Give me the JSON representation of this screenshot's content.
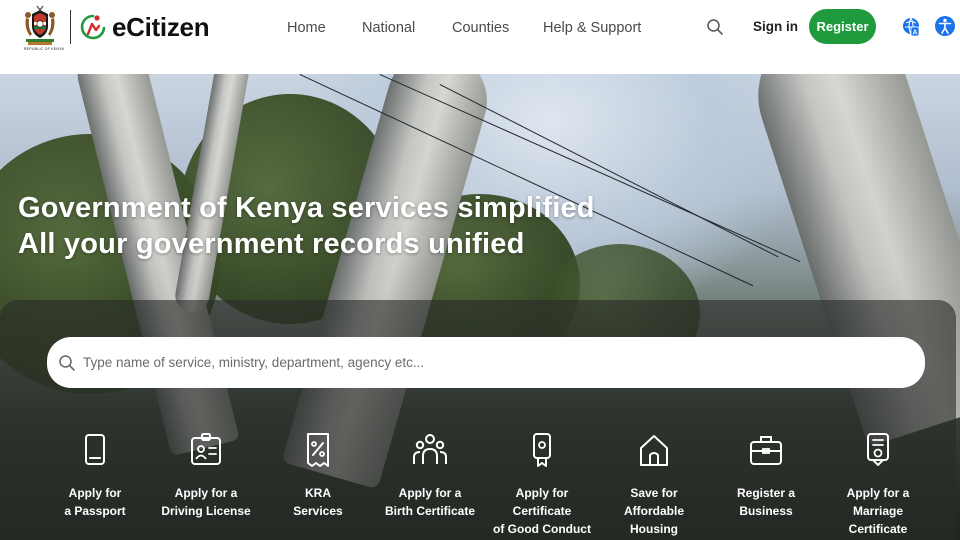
{
  "header": {
    "coat_of_arms_caption": "REPUBLIC OF KENYA",
    "brand_name": "eCitizen",
    "nav": {
      "home": "Home",
      "national": "National",
      "counties": "Counties",
      "help": "Help & Support"
    },
    "search_icon": "search-icon",
    "sign_in": "Sign in",
    "register": "Register",
    "language_icon": "language-icon",
    "accessibility_icon": "accessibility-icon"
  },
  "hero": {
    "headline_line1": "Government of Kenya services simplified",
    "headline_line2": "All your government records unified",
    "search": {
      "placeholder": "Type name of service, ministry, department, agency etc...",
      "value": ""
    }
  },
  "services": [
    {
      "label": "Apply for\na Passport",
      "icon": "passport-icon"
    },
    {
      "label": "Apply for a\nDriving License",
      "icon": "id-card-icon"
    },
    {
      "label": "KRA\nServices",
      "icon": "tax-document-icon"
    },
    {
      "label": "Apply for a\nBirth Certificate",
      "icon": "family-icon"
    },
    {
      "label": "Apply for\nCertificate\nof Good Conduct",
      "icon": "certificate-badge-icon"
    },
    {
      "label": "Save for\nAffordable\nHousing",
      "icon": "house-icon"
    },
    {
      "label": "Register a\nBusiness",
      "icon": "briefcase-icon"
    },
    {
      "label": "Apply for a\nMarriage\nCertificate",
      "icon": "marriage-certificate-icon"
    }
  ],
  "colors": {
    "brand_green": "#1f9b3d",
    "accent_blue": "#1a73e8",
    "ecitizen_red": "#d62b2b"
  }
}
